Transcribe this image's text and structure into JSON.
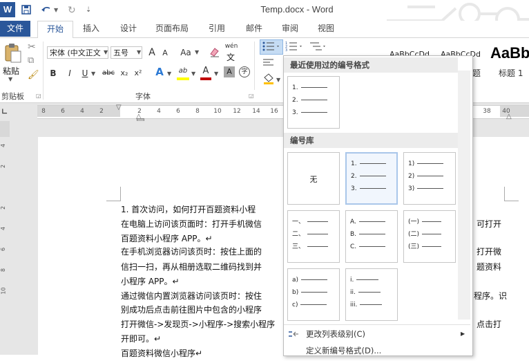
{
  "window": {
    "title": "Temp.docx - Word",
    "app_logo": "W"
  },
  "tabs": [
    {
      "label": "文件",
      "active": false
    },
    {
      "label": "开始",
      "active": true
    },
    {
      "label": "插入",
      "active": false
    },
    {
      "label": "设计",
      "active": false
    },
    {
      "label": "页面布局",
      "active": false
    },
    {
      "label": "引用",
      "active": false
    },
    {
      "label": "邮件",
      "active": false
    },
    {
      "label": "审阅",
      "active": false
    },
    {
      "label": "视图",
      "active": false
    }
  ],
  "ribbon": {
    "paste_label": "粘贴",
    "clipboard_group": "剪贴板",
    "font_group": "字体",
    "font_name": "宋体 (中文正文",
    "font_size": "五号",
    "styles_preview": "AaBbCcDd",
    "styles_preview2": "AaBbCcDd",
    "styles_big": "AaBb",
    "heading_label": "标题 1",
    "style_fragment": "题",
    "grow_font": "A",
    "shrink_font": "A",
    "case_label": "Aa",
    "pinyin_label": "wén",
    "bold": "B",
    "italic": "I",
    "underline": "U",
    "strike": "abc",
    "subscript": "x₂",
    "superscript": "x²",
    "text_effect": "A",
    "highlight": "ab",
    "font_color": "A",
    "char_shade": "A",
    "enclose": "字"
  },
  "ruler": {
    "h_numbers": [
      "8",
      "6",
      "4",
      "2",
      "",
      "2",
      "4",
      "6",
      "8",
      "10",
      "12",
      "14",
      "16",
      "38",
      "40"
    ],
    "v_numbers": [
      "4",
      "2",
      "",
      "2",
      "4",
      "6",
      "8",
      "10"
    ]
  },
  "document": {
    "lines": [
      "1.    首次访问，如何打开百题资料小程",
      "在电脑上访问该页面时：打开手机微信",
      "百题资料小程序 APP。↵",
      "在手机浏览器访问该页时：按住上面的",
      "信扫一扫，再从相册选取二维码找到并",
      "小程序 APP。↵",
      "通过微信内置浏览器访问该页时：按住",
      "别成功后点击前往图片中包含的小程序",
      "打开微信->发现页->小程序->搜索小程序",
      "开即可。↵",
      "百题资料微信小程序↵"
    ],
    "right_fragments": [
      {
        "text": "可打开",
        "line": 1
      },
      {
        "text": "打开微",
        "line": 3
      },
      {
        "text": "题资料",
        "line": 4
      },
      {
        "text": "程序。识",
        "line": 6
      },
      {
        "text": "点击打",
        "line": 8
      }
    ]
  },
  "numbering_dropdown": {
    "recent_header": "最近使用过的编号格式",
    "library_header": "编号库",
    "recent": [
      {
        "items": [
          "1.",
          "2.",
          "3."
        ]
      }
    ],
    "library": [
      {
        "none_label": "无",
        "items": []
      },
      {
        "items": [
          "1.",
          "2.",
          "3."
        ],
        "selected": true
      },
      {
        "items": [
          "1)",
          "2)",
          "3)"
        ]
      },
      {
        "items": [
          "一、",
          "二、",
          "三、"
        ]
      },
      {
        "items": [
          "A.",
          "B.",
          "C."
        ]
      },
      {
        "items": [
          "(一)",
          "(二)",
          "(三)"
        ]
      },
      {
        "items": [
          "a)",
          "b)",
          "c)"
        ]
      },
      {
        "items": [
          "i.",
          "ii.",
          "iii."
        ]
      }
    ],
    "menu": [
      {
        "label": "更改列表级别(C)",
        "icon": "indent-icon",
        "submenu": true
      },
      {
        "label": "定义新编号格式(D)...",
        "icon": "",
        "submenu": false
      }
    ]
  },
  "colors": {
    "brand": "#2b579a",
    "highlight": "#ffff00",
    "font_red": "#c00000"
  }
}
